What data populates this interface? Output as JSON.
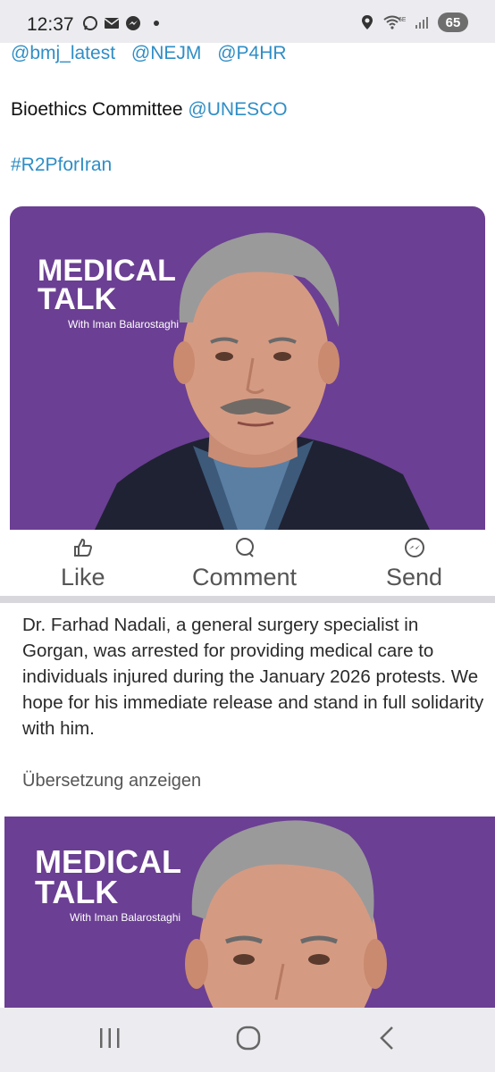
{
  "status_bar": {
    "time": "12:37",
    "battery": "65",
    "network": "6E"
  },
  "tweet": {
    "mentions": [
      "@bmj_latest",
      "@NEJM",
      "@P4HR"
    ],
    "committee_text": "Bioethics Committee",
    "committee_mention": "@UNESCO",
    "hashtag": "#R2PforIran"
  },
  "image_card": {
    "title_line1": "MEDICAL",
    "title_line2": "TALK",
    "subtitle": "With Iman Balarostaghi",
    "background": "#6b3f93"
  },
  "actions": {
    "like": "Like",
    "comment": "Comment",
    "send": "Send"
  },
  "post": {
    "body": "Dr. Farhad Nadali, a general surgery specialist in Gorgan, was arrested for providing medical care to individuals injured during the January 2026 protests. We hope for his immediate release and stand in full solidarity with him.",
    "translate_link": "Übersetzung anzeigen"
  },
  "colors": {
    "link": "#2f8ec6",
    "card_purple": "#6b3f93"
  }
}
